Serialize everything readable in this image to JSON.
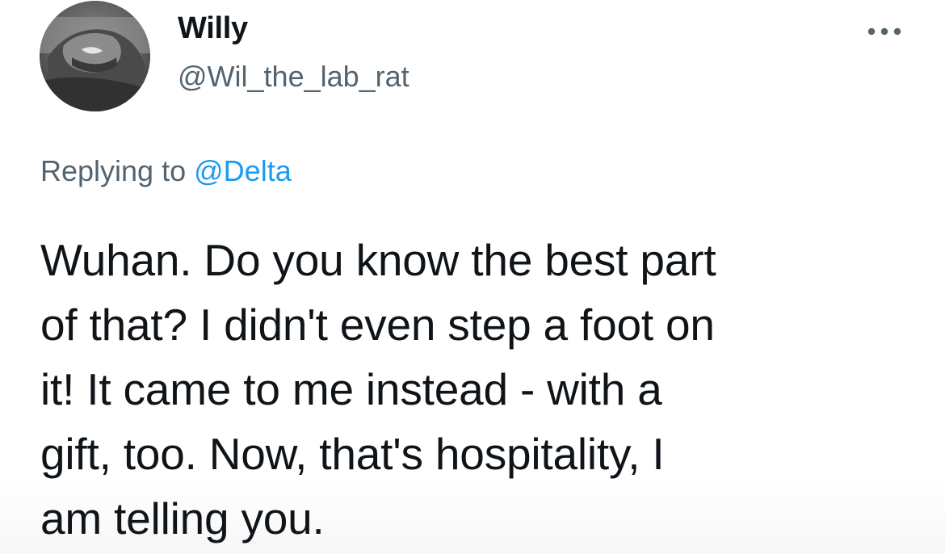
{
  "tweet": {
    "author": {
      "display_name": "Willy",
      "handle": "@Wil_the_lab_rat",
      "avatar_icon": "profile-photo"
    },
    "more_icon": "ellipsis-icon",
    "reply": {
      "prefix": "Replying to",
      "mention": "@Delta"
    },
    "text_lines": [
      "Wuhan. Do you know the best part",
      "of that? I didn't even step a foot on",
      "it! It came to me instead - with a",
      "gift, too. Now, that's hospitality, I",
      "am telling you."
    ],
    "colors": {
      "text": "#0f1419",
      "secondary": "#536471",
      "link": "#1d9bf0"
    }
  }
}
